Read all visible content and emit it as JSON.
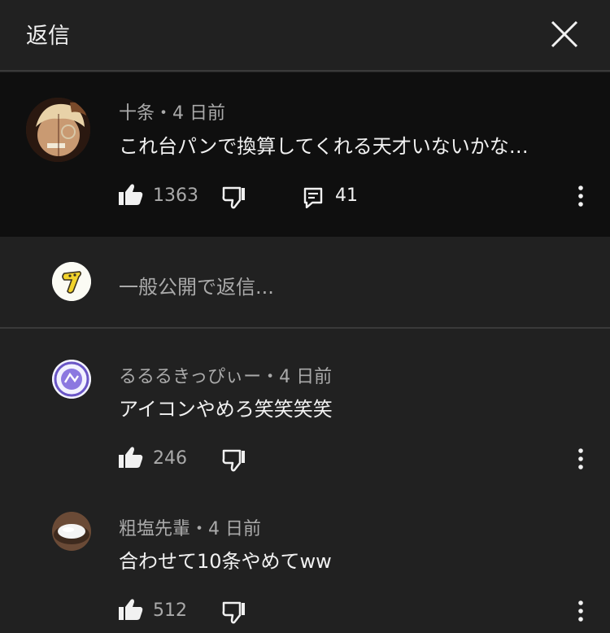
{
  "header": {
    "title": "返信"
  },
  "parent_comment": {
    "author": "十条",
    "time": "4 日前",
    "text": "これ台パンで換算してくれる天才いないかな…",
    "likes": "1363",
    "replies": "41"
  },
  "reply_box": {
    "placeholder": "一般公開で返信..."
  },
  "comments": [
    {
      "author": "るるるきっぴぃー",
      "time": "4 日前",
      "text": "アイコンやめろ笑笑笑笑",
      "likes": "246"
    },
    {
      "author": "粗塩先輩",
      "time": "4 日前",
      "text": "合わせて10条やめてww",
      "likes": "512"
    }
  ],
  "meta_separator": "・",
  "icons": {
    "close": "close-icon",
    "like": "thumb-up-icon",
    "dislike": "thumb-down-icon",
    "reply": "comment-icon",
    "more": "more-vertical-icon"
  }
}
